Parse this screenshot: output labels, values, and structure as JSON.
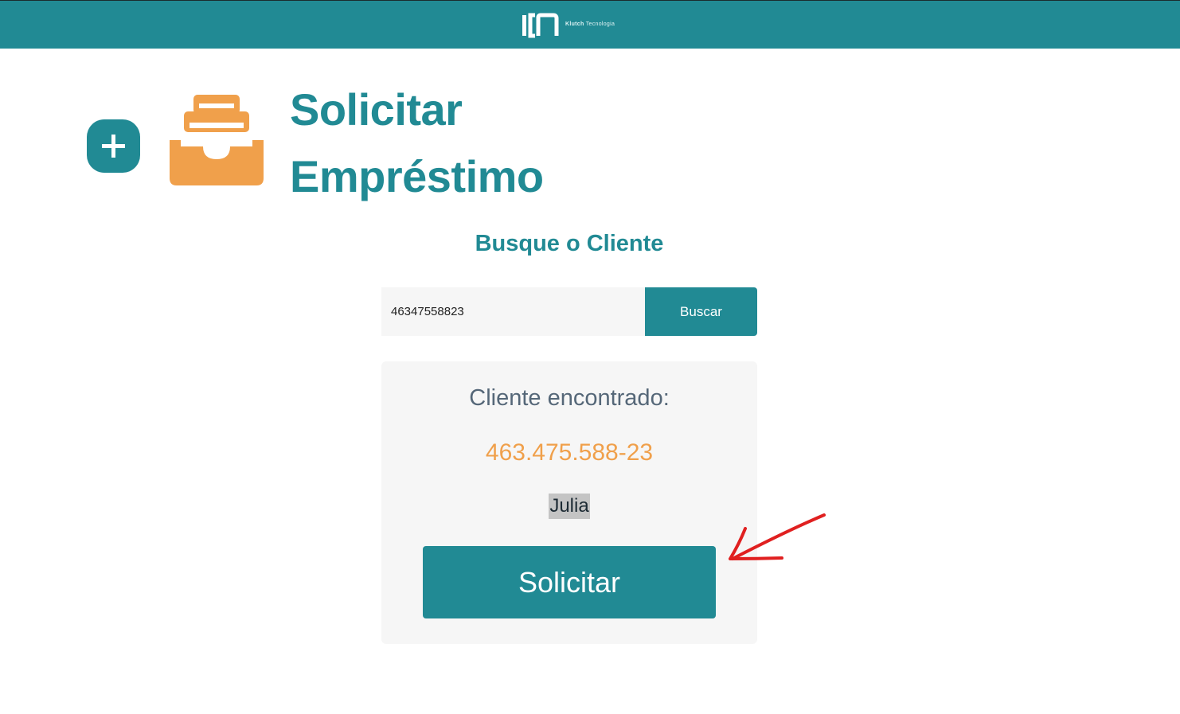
{
  "header": {
    "brand_name": "Klutch",
    "brand_suffix": "Tecnologia",
    "background_color": "#218a94",
    "logo_icon": "kn-monogram-logo"
  },
  "page": {
    "title": "Solicitar Empréstimo",
    "add_icon": "plus-icon",
    "section_icon": "archive-drawer-icon",
    "accent_color": "#218a94",
    "icon_color": "#f0a04b"
  },
  "search": {
    "heading": "Busque o Cliente",
    "input_value": "46347558823",
    "button_label": "Buscar"
  },
  "result": {
    "found_label": "Cliente encontrado:",
    "cpf": "463.475.588-23",
    "client_name": "Julia",
    "request_button_label": "Solicitar",
    "cpf_color": "#f0a04b"
  },
  "annotation": {
    "icon": "red-arrow-annotation",
    "color": "#e02020"
  }
}
